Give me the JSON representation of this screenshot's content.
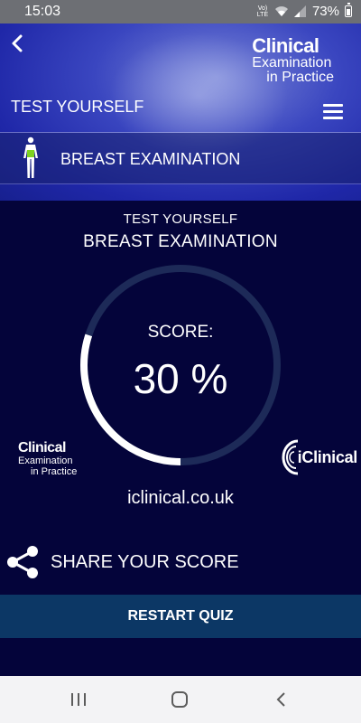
{
  "status_bar": {
    "time": "15:03",
    "volte_line1": "Vo)",
    "volte_line2": "LTE",
    "battery": "73%"
  },
  "header": {
    "logo_main": "Clinical",
    "logo_sub1": "Examination",
    "logo_sub2": "in Practice",
    "page_title": "TEST YOURSELF",
    "section_title": "BREAST EXAMINATION"
  },
  "result": {
    "label": "TEST YOURSELF",
    "topic": "BREAST EXAMINATION",
    "score_label": "SCORE:",
    "score_text": "30 %",
    "score_fraction": 0.3
  },
  "branding": {
    "logo_main": "Clinical",
    "logo_sub1": "Examination",
    "logo_sub2": "in Practice",
    "partner": "iClinical",
    "url": "iclinical.co.uk"
  },
  "actions": {
    "share_label": "SHARE YOUR SCORE",
    "restart_label": "RESTART QUIZ"
  },
  "colors": {
    "background": "#04043a",
    "ring_track": "#1d2a58",
    "ring_fill": "#ffffff",
    "restart_button": "#0c3765"
  }
}
